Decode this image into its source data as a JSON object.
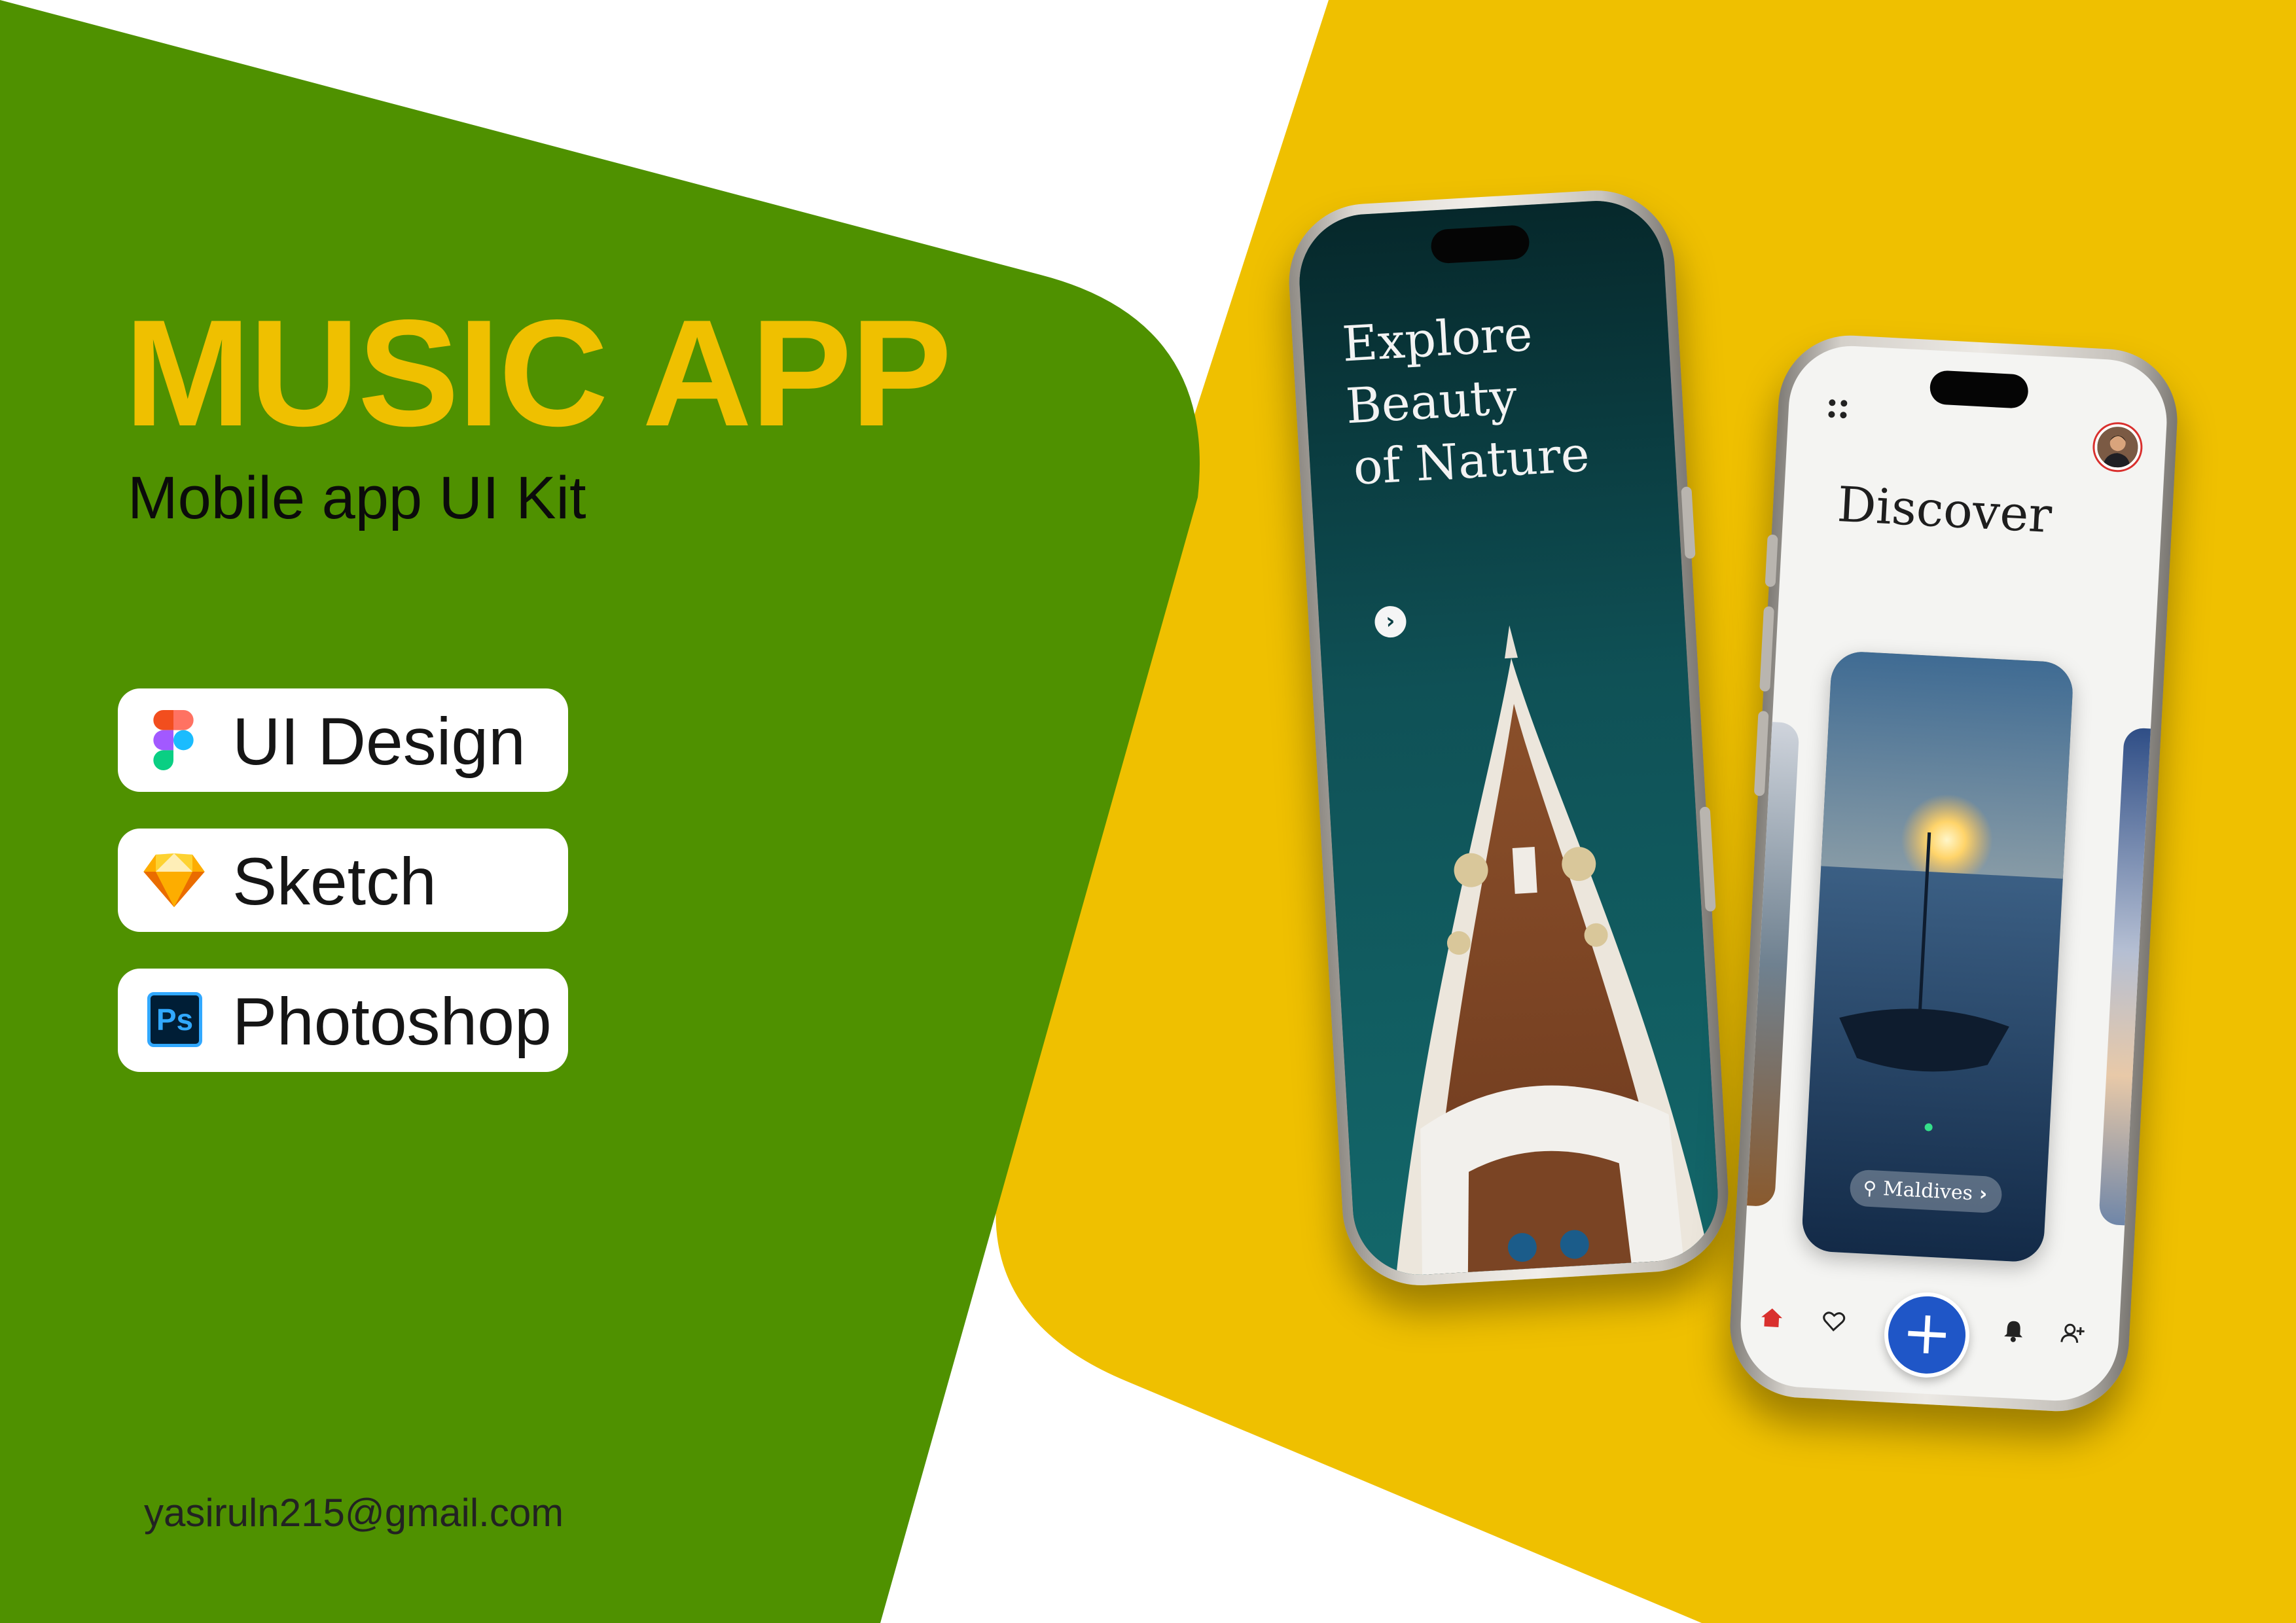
{
  "hero": {
    "title": "MUSIC APP",
    "subtitle": "Mobile app UI Kit"
  },
  "tools": [
    {
      "label": "UI Design",
      "icon": "figma-icon"
    },
    {
      "label": "Sketch",
      "icon": "sketch-icon"
    },
    {
      "label": "Photoshop",
      "icon": "photoshop-icon",
      "icon_text": "Ps"
    }
  ],
  "contact": {
    "email": "yasiruln215@gmail.com"
  },
  "phone1": {
    "headline_lines": [
      "Explore",
      "Beauty",
      "of Nature"
    ],
    "next_icon": "chevron-right-icon"
  },
  "phone2": {
    "title": "Discover",
    "location_label": "Maldives",
    "nav": [
      "home-icon",
      "heart-icon",
      "plus-icon",
      "bell-icon",
      "add-user-icon"
    ]
  },
  "colors": {
    "green": "#4F9100",
    "yellow": "#EFC000",
    "white": "#FFFFFF",
    "title": "#EFC000",
    "fab": "#1F56C7",
    "home_active": "#D9302E"
  }
}
